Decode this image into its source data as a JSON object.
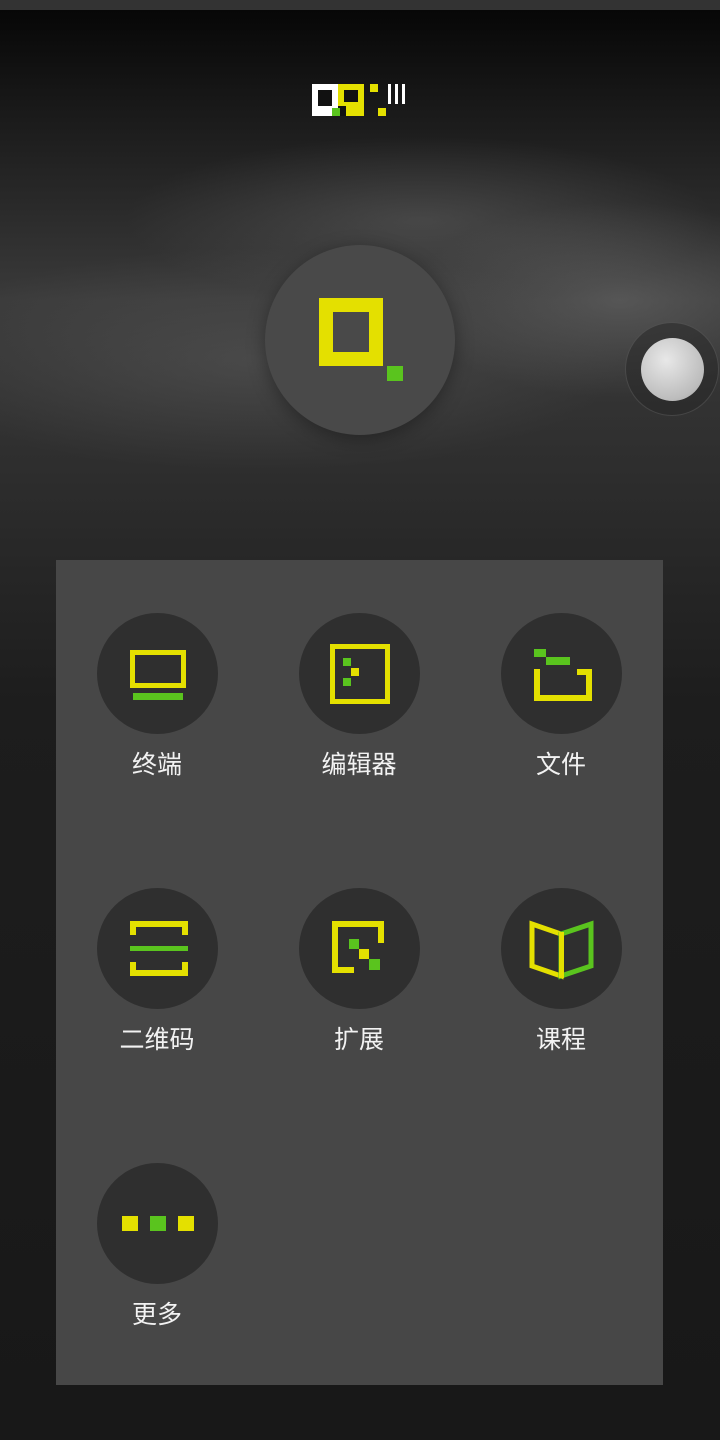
{
  "colors": {
    "yellow": "#e4e000",
    "green": "#5ac41e",
    "panel": "#474747",
    "circle": "#2f2f2f",
    "main_circle": "#494949"
  },
  "header": {
    "logo_icon": "qpython-logo-icon"
  },
  "main_button": {
    "icon": "qpython-start-icon"
  },
  "floating_ball": {
    "icon": "assistive-touch-ball"
  },
  "menu": {
    "items": [
      {
        "label": "终端",
        "icon": "terminal-icon"
      },
      {
        "label": "编辑器",
        "icon": "editor-icon"
      },
      {
        "label": "文件",
        "icon": "folder-icon"
      },
      {
        "label": "二维码",
        "icon": "qrcode-scan-icon"
      },
      {
        "label": "扩展",
        "icon": "extension-icon"
      },
      {
        "label": "课程",
        "icon": "course-book-icon"
      },
      {
        "label": "更多",
        "icon": "more-icon"
      }
    ]
  }
}
